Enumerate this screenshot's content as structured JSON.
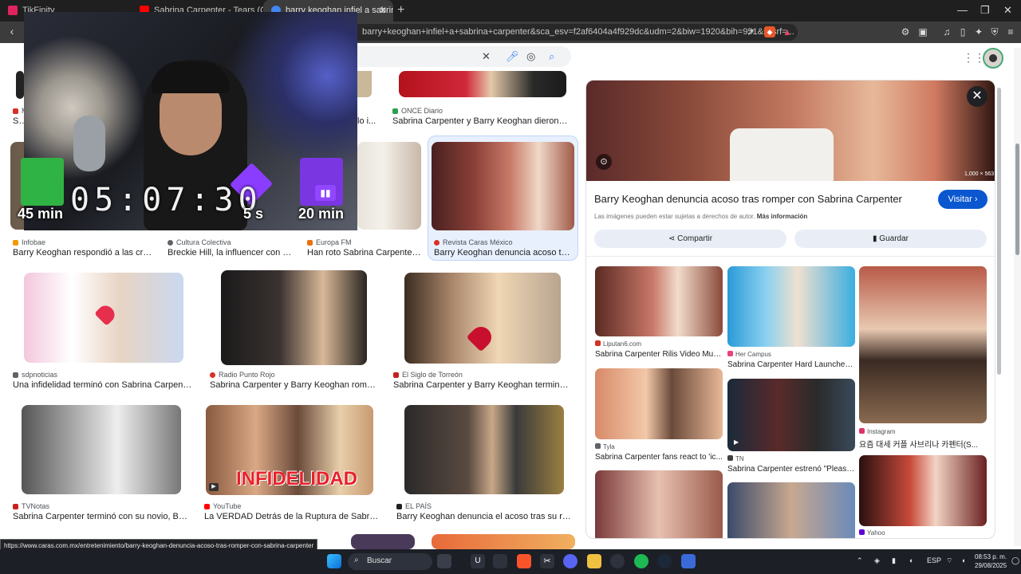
{
  "browser": {
    "tabs": [
      {
        "title": "TikFinity",
        "color": "#e0245e"
      },
      {
        "title": "Sabrina Carpenter - Tears (Official Vi...",
        "color": "#ff0000"
      },
      {
        "title": "barry keoghan infiel a sabrina ca",
        "color": "#4285f4"
      }
    ],
    "url": "barry+keoghan+infiel+a+sabrina+carpenter&sca_esv=f2af6404a4f929dc&udm=2&biw=1920&bih=951&sxsrf=..."
  },
  "overlay": {
    "timer": "05:07:30",
    "gifts": [
      {
        "label": "45 min",
        "color": "#2fb344"
      },
      {
        "label": "5 s",
        "color": "#8b3dff"
      },
      {
        "label": "20 min",
        "color": "#7a36e0"
      }
    ]
  },
  "results": [
    {
      "source": "ONCE Diario",
      "caption": "Sabrina Carpenter y Barry Keoghan dieron fin a s...",
      "icon_color": "#2e9e4f"
    },
    {
      "source": "Infobae",
      "caption": "Barry Keoghan respondió a las crítica...",
      "icon_color": "#f29900"
    },
    {
      "source": "Cultura Colectiva",
      "caption": "Breckie Hill, la influencer con quie...",
      "icon_color": "#5f6368"
    },
    {
      "source": "Europa FM",
      "caption": "Han roto Sabrina Carpenter y ...",
      "icon_color": "#e8710a"
    },
    {
      "source": "Revista Caras México",
      "caption": "Barry Keoghan denuncia acoso tras ro...",
      "icon_color": "#d93025"
    },
    {
      "source": "sdpnoticias",
      "caption": "Una infidelidad terminó con Sabrina Carpenter y B...",
      "icon_color": "#5f6368"
    },
    {
      "source": "Radio Punto Rojo",
      "caption": "Sabrina Carpenter y Barry Keoghan rompen tr...",
      "icon_color": "#d93025"
    },
    {
      "source": "El Siglo de Torreón",
      "caption": "Sabrina Carpenter y Barry Keoghan terminan su r...",
      "icon_color": "#c5221f"
    },
    {
      "source": "TVNotas",
      "caption": "Sabrina Carpenter terminó con su novio, Barry K...",
      "icon_color": "#c5221f"
    },
    {
      "source": "YouTube",
      "caption": "La VERDAD Detrás de la Ruptura de Sabrina Car...",
      "icon_color": "#ff0000"
    },
    {
      "source": "EL PAÍS",
      "caption": "Barry Keoghan denuncia el acoso tras su ruptura...",
      "icon_color": "#202124"
    }
  ],
  "infidelidad_text": "INFIDELIDAD",
  "panel": {
    "dims": "1,000 × 563",
    "title": "Barry Keoghan denuncia acoso tras romper con Sabrina Carpenter",
    "visit": "Visitar",
    "rights": "Las imágenes pueden estar sujetas a derechos de autor.",
    "more_info": "Más información",
    "share": "Compartir",
    "save": "Guardar",
    "related": [
      {
        "source": "Liputan6.com",
        "caption": "Sabrina Carpenter Rilis Video Musi..."
      },
      {
        "source": "Her Campus",
        "caption": "Sabrina Carpenter Hard Launched ..."
      },
      {
        "source": "Instagram",
        "caption": "요즘 대세 커플 사브리나 카펜터(S..."
      },
      {
        "source": "Tyla",
        "caption": "Sabrina Carpenter fans react to 'ic..."
      },
      {
        "source": "TN",
        "caption": "Sabrina Carpenter estrenó \"Please..."
      },
      {
        "source": "Yahoo",
        "caption": ""
      }
    ]
  },
  "status_url": "https://www.caras.com.mx/entretenimiento/barry-keoghan-denuncia-acoso-tras-romper-con-sabrina-carpenter",
  "taskbar": {
    "search": "Buscar",
    "lang": "ESP",
    "time": "08:53 p. m.",
    "date": "29/08/2025"
  }
}
